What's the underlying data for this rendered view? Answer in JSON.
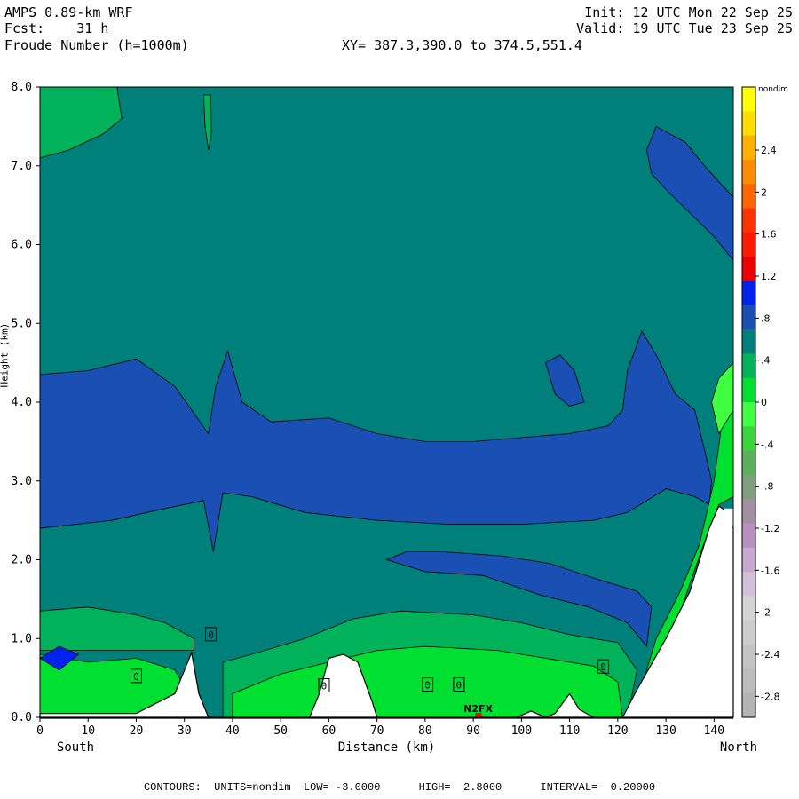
{
  "header": {
    "model": "AMPS 0.89-km WRF",
    "forecast": "Fcst:    31 h",
    "field": "Froude Number (h=1000m)",
    "init": "Init: 12 UTC Mon 22 Sep 25",
    "valid": "Valid: 19 UTC Tue 23 Sep 25",
    "xy": "XY= 387.3,390.0 to 374.5,551.4"
  },
  "chart_data": {
    "type": "heatmap",
    "title": "Froude Number (h=1000m)",
    "xlabel": "Distance (km)",
    "ylabel": "Height (km)",
    "x_ticks": [
      "0",
      "10",
      "20",
      "30",
      "40",
      "50",
      "60",
      "70",
      "80",
      "90",
      "100",
      "110",
      "120",
      "130",
      "140"
    ],
    "y_ticks": [
      "0.0",
      "1.0",
      "2.0",
      "3.0",
      "4.0",
      "5.0",
      "6.0",
      "7.0",
      "8.0"
    ],
    "xlim": [
      0,
      144
    ],
    "ylim": [
      0,
      8
    ],
    "x_end_labels": {
      "left": "South",
      "right": "North"
    },
    "station_label": "N2FX",
    "station_distance_km": 91,
    "zero_contour_labels": [
      "0",
      "0",
      "0",
      "0",
      "0",
      "0",
      "0"
    ],
    "colorbar": {
      "units": "nondim",
      "tick_labels": [
        "2.4",
        "2",
        "1.6",
        "1.2",
        ".8",
        ".4",
        "0",
        "-.4",
        "-.8",
        "-1.2",
        "-1.6",
        "-2",
        "-2.4",
        "-2.8"
      ],
      "tick_values": [
        2.4,
        2.0,
        1.6,
        1.2,
        0.8,
        0.4,
        0.0,
        -0.4,
        -0.8,
        -1.2,
        -1.6,
        -2.0,
        -2.4,
        -2.8
      ],
      "colors_top_to_bottom": [
        "#ffff00",
        "#ffdd00",
        "#ffb000",
        "#ff8c00",
        "#ff6600",
        "#ff3300",
        "#ff1a00",
        "#ee0000",
        "#0022ee",
        "#1a4fb4",
        "#00807a",
        "#00b25a",
        "#00e030",
        "#40ff40",
        "#3bd43b",
        "#5cb05c",
        "#7f9f7f",
        "#a090a0",
        "#b890c0",
        "#c8a8d0",
        "#d0c0d8",
        "#d4d4d4",
        "#cccccc",
        "#c4c4c4",
        "#bcbcbc",
        "#b4b4b4"
      ],
      "value_range": [
        -3.0,
        3.0
      ]
    },
    "terrain_peaks_km": [
      0,
      31.5,
      36,
      63,
      102,
      110,
      121,
      143
    ],
    "footer": "CONTOURS:  UNITS=nondim  LOW= -3.0000      HIGH=  2.8000      INTERVAL=  0.20000"
  }
}
